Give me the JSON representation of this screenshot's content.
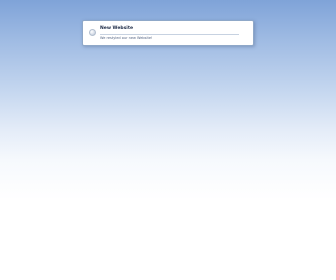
{
  "notice": {
    "icon": "info-dot-icon",
    "title": "New Website",
    "message": "We restyled our new Website!"
  },
  "colors": {
    "background_top": "#7fa3d8",
    "background_bottom": "#ffffff",
    "dialog_border": "#8fa8c8"
  }
}
